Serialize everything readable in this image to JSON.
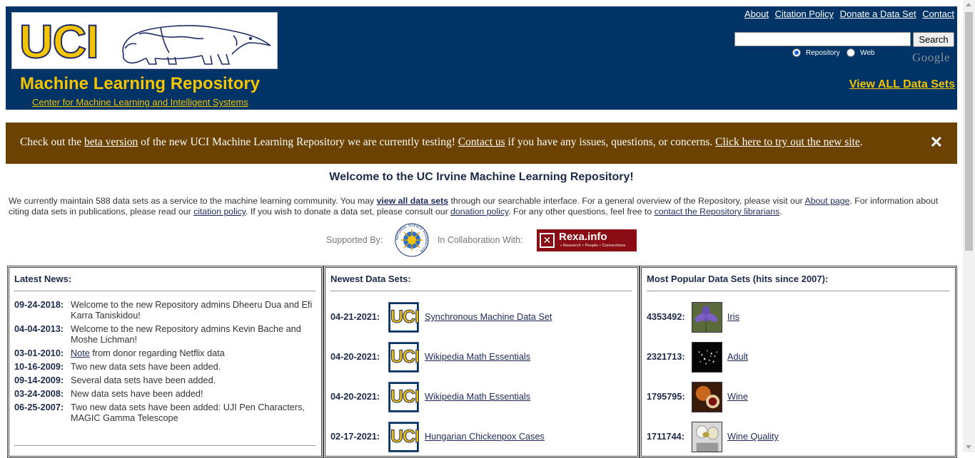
{
  "header": {
    "logo_text": "UCI",
    "title": "Machine Learning Repository",
    "subtitle_link": "Center for Machine Learning and Intelligent Systems",
    "nav_links": [
      "About",
      "Citation Policy",
      "Donate a Data Set",
      "Contact"
    ],
    "search": {
      "value": "",
      "button_label": "Search"
    },
    "radio_repository": "Repository",
    "radio_web": "Web",
    "google_label": "Google",
    "view_all_link": "View ALL Data Sets"
  },
  "banner": {
    "text1": "Check out the ",
    "link1": "beta version",
    "text2": " of the new UCI Machine Learning Repository we are currently testing! ",
    "link2": "Contact us",
    "text3": " if you have any issues, questions, or concerns. ",
    "link3": "Click here to try out the new site",
    "text4": ".",
    "close_glyph": "✕"
  },
  "welcome": {
    "title": "Welcome to the UC Irvine Machine Learning Repository!",
    "p1": "We currently maintain 588 data sets as a service to the machine learning community. You may ",
    "l1": "view all data sets",
    "p2": " through our searchable interface. For a general overview of the Repository, please visit our ",
    "l2": "About page",
    "p3": ". For information about citing data sets in publications, please read our ",
    "l3": "citation policy",
    "p4": ". If you wish to donate a data set, please consult our ",
    "l4": "donation policy",
    "p5": ". For any other questions, feel free to ",
    "l5": "contact the Repository librarians",
    "p6": ".",
    "supported_by": "Supported By:",
    "collaboration": "In Collaboration With:",
    "nsf_ring_text": "NATIONAL SCIENCE FOUNDATION",
    "rexa_name": "Rexa.info",
    "rexa_tagline": "• Research • People • Connections"
  },
  "news": {
    "title": "Latest News:",
    "items": [
      {
        "date": "09-24-2018:",
        "text": "Welcome to the new Repository admins Dheeru Dua and Efi Karra Taniskidou!"
      },
      {
        "date": "04-04-2013:",
        "text": "Welcome to the new Repository admins Kevin Bache and Moshe Lichman!"
      },
      {
        "date": "03-01-2010:",
        "link": "Note",
        "text": " from donor regarding Netflix data"
      },
      {
        "date": "10-16-2009:",
        "text": "Two new data sets have been added."
      },
      {
        "date": "09-14-2009:",
        "text": "Several data sets have been added."
      },
      {
        "date": "03-24-2008:",
        "text": "New data sets have been added!"
      },
      {
        "date": "06-25-2007:",
        "text": "Two new data sets have been added: UJI Pen Characters, MAGIC Gamma Telescope"
      }
    ]
  },
  "newest": {
    "title": "Newest Data Sets:",
    "thumb_text": "UCI",
    "items": [
      {
        "date": "04-21-2021:",
        "name": "Synchronous Machine Data Set"
      },
      {
        "date": "04-20-2021:",
        "name": "Wikipedia Math Essentials"
      },
      {
        "date": "04-20-2021:",
        "name": "Wikipedia Math Essentials"
      },
      {
        "date": "02-17-2021:",
        "name": "Hungarian Chickenpox Cases"
      }
    ]
  },
  "popular": {
    "title": "Most Popular Data Sets (hits since 2007):",
    "items": [
      {
        "count": "4353492:",
        "name": "Iris"
      },
      {
        "count": "2321713:",
        "name": "Adult"
      },
      {
        "count": "1795795:",
        "name": "Wine"
      },
      {
        "count": "1711744:",
        "name": "Wine Quality"
      }
    ]
  },
  "colors": {
    "header_bg": "#003366",
    "accent_yellow": "#f5c400",
    "banner_bg": "#6b4202",
    "rexa_red": "#8a0d15"
  }
}
